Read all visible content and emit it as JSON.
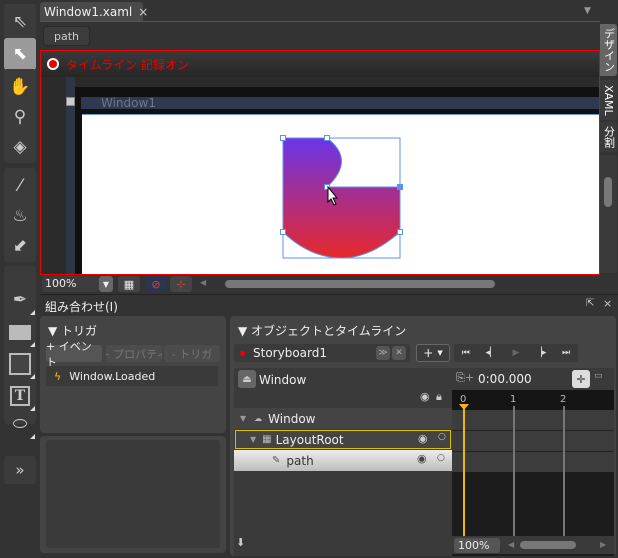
{
  "toolbar": {
    "tools": [
      "selection-tool",
      "direct-selection-tool",
      "pan-tool",
      "zoom-tool",
      "camera-orbit-tool",
      "eyedropper-tool",
      "paint-bucket-tool",
      "gradient-tool",
      "pen-tool",
      "rectangle-tool",
      "grid-tool",
      "text-tool",
      "control-tool",
      "asset-library"
    ]
  },
  "document": {
    "tab_label": "Window1.xaml",
    "close": "×",
    "breadcrumb": "path",
    "record_label": "タイムライン 記録オン",
    "window_title": "Window1",
    "zoom": "100%"
  },
  "view_tabs": {
    "design": "デザイン",
    "xaml": "XAML",
    "split": "分割"
  },
  "panel": {
    "title": "組み合わせ(I)"
  },
  "triggers": {
    "header": "▼ トリガ",
    "add_event": "+ イベント",
    "add_property": "+ プロパティ",
    "remove_trigger": "- トリガ",
    "items": [
      "Window.Loaded"
    ]
  },
  "objects": {
    "header": "▼ オブジェクトとタイムライン",
    "storyboard": "Storyboard1",
    "add": "+",
    "scope": "Window",
    "time": "0:00.000",
    "ticks": [
      "0",
      "1",
      "2"
    ],
    "tree": [
      {
        "label": "Window"
      },
      {
        "label": "LayoutRoot"
      },
      {
        "label": "path"
      }
    ],
    "timeline_zoom": "100%"
  },
  "colors": {
    "record": "#e00000",
    "gradient_top": "#6a35e8",
    "gradient_bottom": "#e8282a",
    "playhead": "#f0b800",
    "selection": "#5b93e8"
  }
}
